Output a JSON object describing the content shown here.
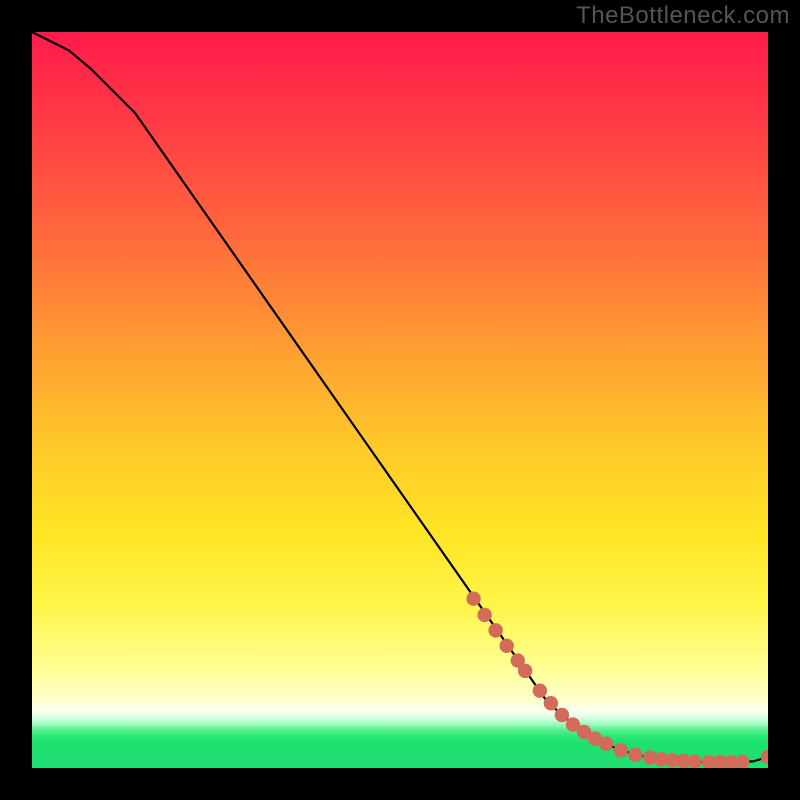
{
  "watermark": "TheBottleneck.com",
  "chart_data": {
    "type": "line",
    "title": "",
    "xlabel": "",
    "ylabel": "",
    "xlim": [
      0,
      100
    ],
    "ylim": [
      0,
      100
    ],
    "series": [
      {
        "name": "curve",
        "x": [
          0,
          2,
          5,
          8,
          11,
          14,
          70,
          74,
          78,
          82,
          85,
          88,
          92,
          95,
          98,
          100
        ],
        "y": [
          100,
          99,
          97.5,
          95,
          92,
          89,
          9,
          5.5,
          3.2,
          1.8,
          1.2,
          0.9,
          0.8,
          0.8,
          0.9,
          1.5
        ]
      }
    ],
    "points": {
      "name": "markers",
      "color": "#d46a5a",
      "x": [
        60,
        61.5,
        63,
        64.5,
        66,
        67,
        69,
        70.5,
        72,
        73.5,
        75,
        76.5,
        78,
        80,
        82,
        84,
        85.5,
        87,
        88.5,
        90,
        92,
        93.5,
        95,
        96.5,
        100
      ],
      "y": [
        23,
        20.8,
        18.7,
        16.6,
        14.6,
        13.2,
        10.5,
        8.8,
        7.2,
        5.9,
        4.9,
        4.0,
        3.3,
        2.4,
        1.8,
        1.4,
        1.2,
        1.05,
        0.95,
        0.88,
        0.82,
        0.8,
        0.8,
        0.82,
        1.5
      ]
    }
  }
}
